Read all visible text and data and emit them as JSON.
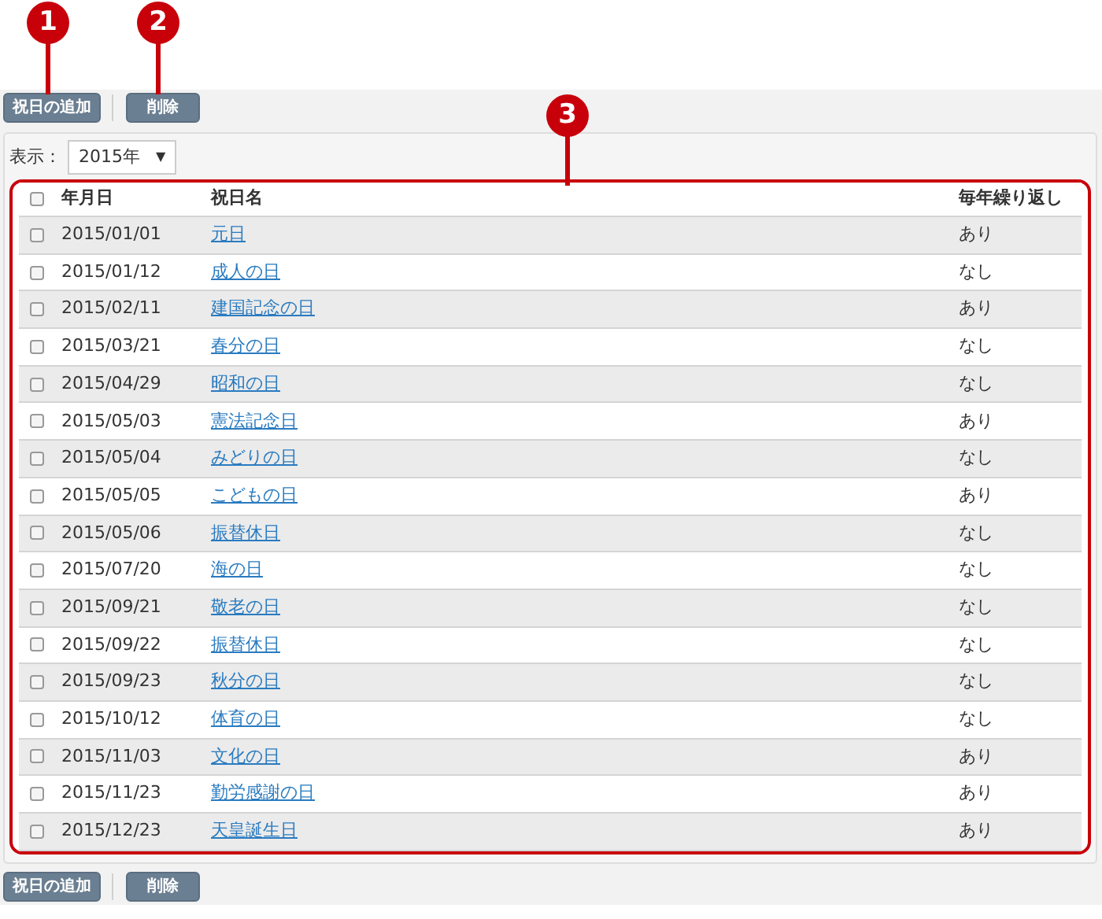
{
  "callouts": [
    {
      "label": "1"
    },
    {
      "label": "2"
    },
    {
      "label": "3"
    }
  ],
  "toolbar_top": {
    "buttons": [
      "祝日の追加",
      "削除"
    ]
  },
  "filter": {
    "label": "表示：",
    "value": "2015年",
    "caret": "▼"
  },
  "table": {
    "columns": [
      "年月日",
      "祝日名",
      "毎年繰り返し"
    ],
    "select_all_checked": false,
    "rows": [
      {
        "date": "2015/01/01",
        "name": "元日",
        "repeat": "あり",
        "checked": false
      },
      {
        "date": "2015/01/12",
        "name": "成人の日",
        "repeat": "なし",
        "checked": false
      },
      {
        "date": "2015/02/11",
        "name": "建国記念の日",
        "repeat": "あり",
        "checked": false
      },
      {
        "date": "2015/03/21",
        "name": "春分の日",
        "repeat": "なし",
        "checked": false
      },
      {
        "date": "2015/04/29",
        "name": "昭和の日",
        "repeat": "なし",
        "checked": false
      },
      {
        "date": "2015/05/03",
        "name": "憲法記念日",
        "repeat": "あり",
        "checked": false
      },
      {
        "date": "2015/05/04",
        "name": "みどりの日",
        "repeat": "なし",
        "checked": false
      },
      {
        "date": "2015/05/05",
        "name": "こどもの日",
        "repeat": "あり",
        "checked": false
      },
      {
        "date": "2015/05/06",
        "name": "振替休日",
        "repeat": "なし",
        "checked": false
      },
      {
        "date": "2015/07/20",
        "name": "海の日",
        "repeat": "なし",
        "checked": false
      },
      {
        "date": "2015/09/21",
        "name": "敬老の日",
        "repeat": "なし",
        "checked": false
      },
      {
        "date": "2015/09/22",
        "name": "振替休日",
        "repeat": "なし",
        "checked": false
      },
      {
        "date": "2015/09/23",
        "name": "秋分の日",
        "repeat": "なし",
        "checked": false
      },
      {
        "date": "2015/10/12",
        "name": "体育の日",
        "repeat": "なし",
        "checked": false
      },
      {
        "date": "2015/11/03",
        "name": "文化の日",
        "repeat": "あり",
        "checked": false
      },
      {
        "date": "2015/11/23",
        "name": "勤労感謝の日",
        "repeat": "あり",
        "checked": false
      },
      {
        "date": "2015/12/23",
        "name": "天皇誕生日",
        "repeat": "あり",
        "checked": false
      }
    ]
  },
  "toolbar_bottom": {
    "buttons": [
      "祝日の追加",
      "削除"
    ]
  }
}
